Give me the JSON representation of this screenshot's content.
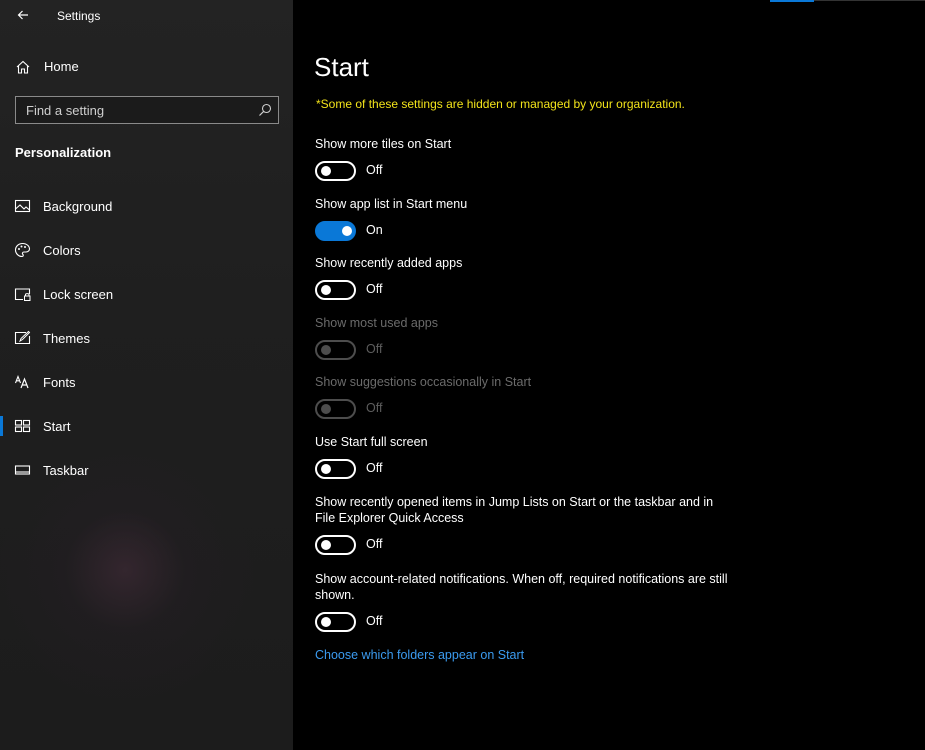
{
  "app": {
    "title": "Settings"
  },
  "sidebar": {
    "home_label": "Home",
    "search_placeholder": "Find a setting",
    "section": "Personalization",
    "items": [
      {
        "label": "Background",
        "icon": "background-icon",
        "selected": false
      },
      {
        "label": "Colors",
        "icon": "palette-icon",
        "selected": false
      },
      {
        "label": "Lock screen",
        "icon": "lock-screen-icon",
        "selected": false
      },
      {
        "label": "Themes",
        "icon": "themes-icon",
        "selected": false
      },
      {
        "label": "Fonts",
        "icon": "fonts-icon",
        "selected": false
      },
      {
        "label": "Start",
        "icon": "start-icon",
        "selected": true
      },
      {
        "label": "Taskbar",
        "icon": "taskbar-icon",
        "selected": false
      }
    ]
  },
  "main": {
    "title": "Start",
    "org_note": "*Some of these settings are hidden or managed by your organization.",
    "settings": [
      {
        "label": "Show more tiles on Start",
        "state": "Off",
        "on": false,
        "disabled": false
      },
      {
        "label": "Show app list in Start menu",
        "state": "On",
        "on": true,
        "disabled": false
      },
      {
        "label": "Show recently added apps",
        "state": "Off",
        "on": false,
        "disabled": false
      },
      {
        "label": "Show most used apps",
        "state": "Off",
        "on": false,
        "disabled": true
      },
      {
        "label": "Show suggestions occasionally in Start",
        "state": "Off",
        "on": false,
        "disabled": true
      },
      {
        "label": "Use Start full screen",
        "state": "Off",
        "on": false,
        "disabled": false
      },
      {
        "label": "Show recently opened items in Jump Lists on Start or the taskbar and in File Explorer Quick Access",
        "state": "Off",
        "on": false,
        "disabled": false
      },
      {
        "label": "Show account-related notifications. When off, required notifications are still shown.",
        "state": "Off",
        "on": false,
        "disabled": false
      }
    ],
    "link": "Choose which folders appear on Start"
  },
  "colors": {
    "accent": "#0a78d7",
    "warning_text": "#f2e31a",
    "link": "#3b9bf0",
    "disabled": "#5e5e5e"
  }
}
